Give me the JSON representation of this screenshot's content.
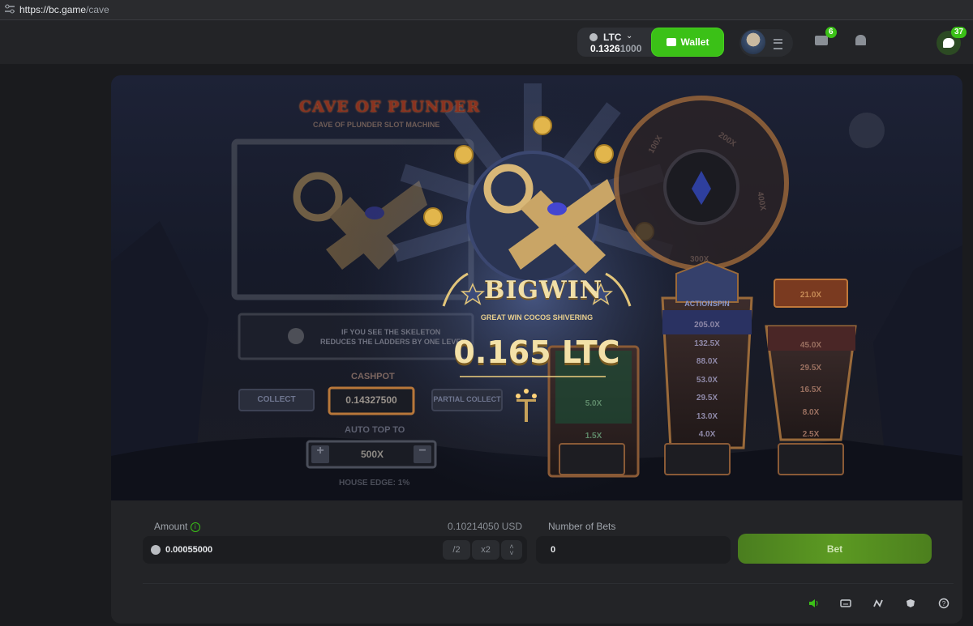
{
  "browser": {
    "url_host": "https://bc.game",
    "url_path": "/cave"
  },
  "header": {
    "currency": "LTC",
    "balance_main": "0.1326",
    "balance_tail": "1000",
    "wallet_label": "Wallet",
    "mail_badge": "6",
    "chat_badge": "37",
    "accent": "#3bc117"
  },
  "game": {
    "title": "CAVE OF PLUNDER",
    "subtitle": "CAVE OF PLUNDER SLOT MACHINE",
    "skeleton_hint_1": "IF YOU SEE THE SKELETON",
    "skeleton_hint_2": "REDUCES THE LADDERS BY ONE LEVEL",
    "cashpot_label": "CASHPOT",
    "collect_label": "COLLECT",
    "cashpot_value": "0.14327500",
    "partial_collect_label": "PARTIAL COLLECT",
    "auto_top_label": "AUTO TOP TO",
    "auto_top_value": "500X",
    "house_edge": "HOUSE EDGE: 1%",
    "bigwin_title": "BIGWIN",
    "bigwin_sub": "GREAT WIN COCOS SHIVERING",
    "win_amount": "0.165 LTC",
    "wheel_labels": [
      "100X",
      "200X",
      "400X",
      "300X"
    ],
    "actionspin_label": "ACTIONSPIN",
    "ladder_mid": [
      "205.0X",
      "132.5X",
      "88.0X",
      "53.0X",
      "29.5X",
      "13.0X",
      "4.0X"
    ],
    "ladder_left": [
      "5.0X",
      "1.5X"
    ],
    "ladder_right_top": "21.0X",
    "ladder_right": [
      "45.0X",
      "29.5X",
      "16.5X",
      "8.0X",
      "2.5X"
    ]
  },
  "controls": {
    "amount_label": "Amount",
    "amount_value": "0.00055000",
    "usd_value": "0.10214050 USD",
    "half_label": "/2",
    "double_label": "x2",
    "bets_label": "Number of Bets",
    "bets_value": "0",
    "bet_button": "Bet"
  },
  "footer_icons": [
    "sound-icon",
    "keyboard-icon",
    "stats-icon",
    "fairness-icon",
    "help-icon"
  ]
}
